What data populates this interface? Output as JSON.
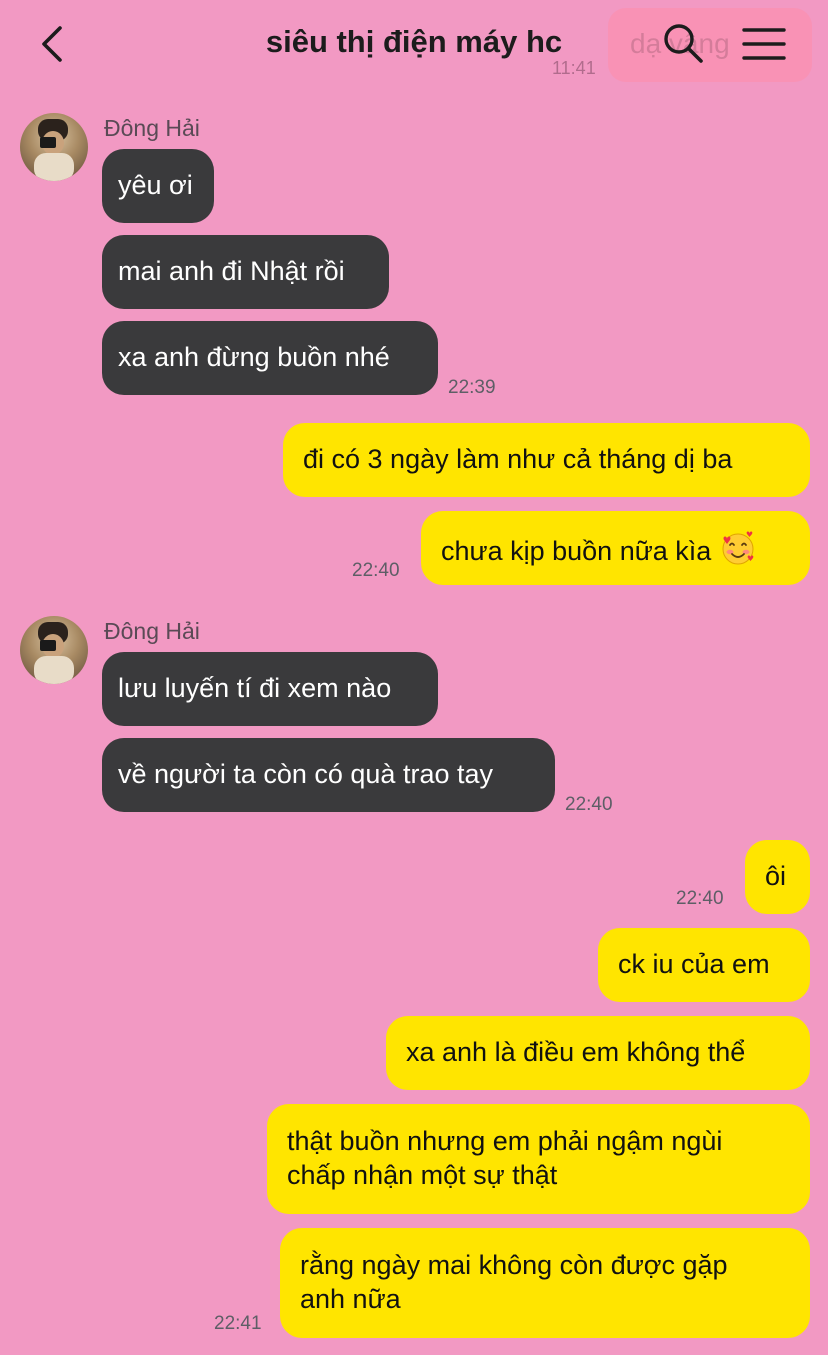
{
  "header": {
    "title": "siêu thị điện máy hc",
    "ghost_text": "dạ vâng",
    "ghost_time": "11:41"
  },
  "messages": {
    "g1_sender": "Đông Hải",
    "m1": "yêu ơi",
    "m2": "mai anh đi Nhật rồi",
    "m3": "xa anh đừng buồn nhé",
    "t1": "22:39",
    "m4": "đi có 3 ngày làm như cả tháng dị ba",
    "m5": "chưa kịp buồn nữa kìa",
    "t2": "22:40",
    "g2_sender": "Đông Hải",
    "m6": "lưu luyến tí đi xem nào",
    "m7": "về người ta còn có quà trao tay",
    "t3": "22:40",
    "m8": "ôi",
    "t4": "22:40",
    "m9": "ck iu của em",
    "m10": "xa anh là điều em không thể",
    "m11_l1": "thật buồn nhưng em phải ngậm ngùi",
    "m11_l2": "chấp nhận một sự thật",
    "m12_l1": "rằng ngày mai không còn được gặp",
    "m12_l2": "anh nữa",
    "t5": "22:41"
  },
  "icons": {
    "back": "chevron-left-icon",
    "search": "search-icon",
    "menu": "hamburger-menu-icon",
    "emoji": "smiling-face-with-hearts-emoji"
  },
  "colors": {
    "background": "#f299c3",
    "incoming_bubble": "#3a3a3c",
    "outgoing_bubble": "#ffe500"
  }
}
